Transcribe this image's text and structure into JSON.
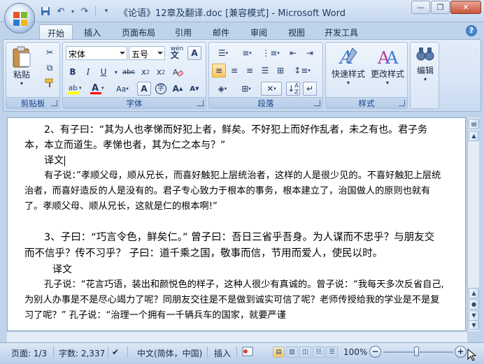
{
  "window": {
    "title": "《论语》12章及翻译.doc [兼容模式] - Microsoft Word"
  },
  "tabs": [
    "开始",
    "插入",
    "页面布局",
    "引用",
    "邮件",
    "审阅",
    "视图",
    "开发工具"
  ],
  "ribbon": {
    "clipboard": {
      "label": "剪贴板",
      "paste": "粘贴"
    },
    "font": {
      "label": "字体",
      "font_name": "宋体",
      "font_size": "五号",
      "grow_font": "A",
      "shrink_font": "A"
    },
    "paragraph": {
      "label": "段落"
    },
    "styles": {
      "label": "样式",
      "quick_styles": "快速样式",
      "change_styles": "更改样式"
    },
    "editing": {
      "label": "编辑",
      "edit": "编辑"
    }
  },
  "document": {
    "p1": "2、有子曰：“其为人也孝悌而好犯上者，鲜矣。不好犯上而好作乱者，未之有也。君子务本，本立而道生。孝悌也者，其为仁之本与？”",
    "p1_trans_heading": "译文",
    "p1_trans": "有子说：”孝顺父母，顺从兄长，而喜好触犯上层统治者，这样的人是很少见的。不喜好触犯上层统治者，而喜好造反的人是没有的。君子专心致力于根本的事务，根本建立了，治国做人的原则也就有了。孝顺父母、顺从兄长，这就是仁的根本啊!”",
    "p2": "3、子曰：“巧言令色，鲜矣仁。” 曾子曰：吾日三省乎吾身。为人谋而不忠乎？与朋友交而不信乎？传不习乎？ 子曰：道千乘之国，敬事而信，节用而爱人，使民以时。",
    "p2_trans_heading": "译文",
    "p2_trans": "孔子说：“花言巧语，装出和颜悦色的样子，这种人很少有真诚的。曾子说：“我每天多次反省自己,为别人办事是不是尽心竭力了呢？同朋友交往是不是做到诚实可信了呢？老师传授给我的学业是不是复习了呢？” 孔子说：“治理一个拥有一千辆兵车的国家，就要严谨"
  },
  "status": {
    "page": "页面: 1/3",
    "words": "字数: 2,337",
    "language": "中文(简体，中国)",
    "mode": "插入",
    "zoom": "100%"
  },
  "colors": {
    "accent": "#15428b",
    "highlight": "#ffff00",
    "font_color": "#ff0000"
  }
}
